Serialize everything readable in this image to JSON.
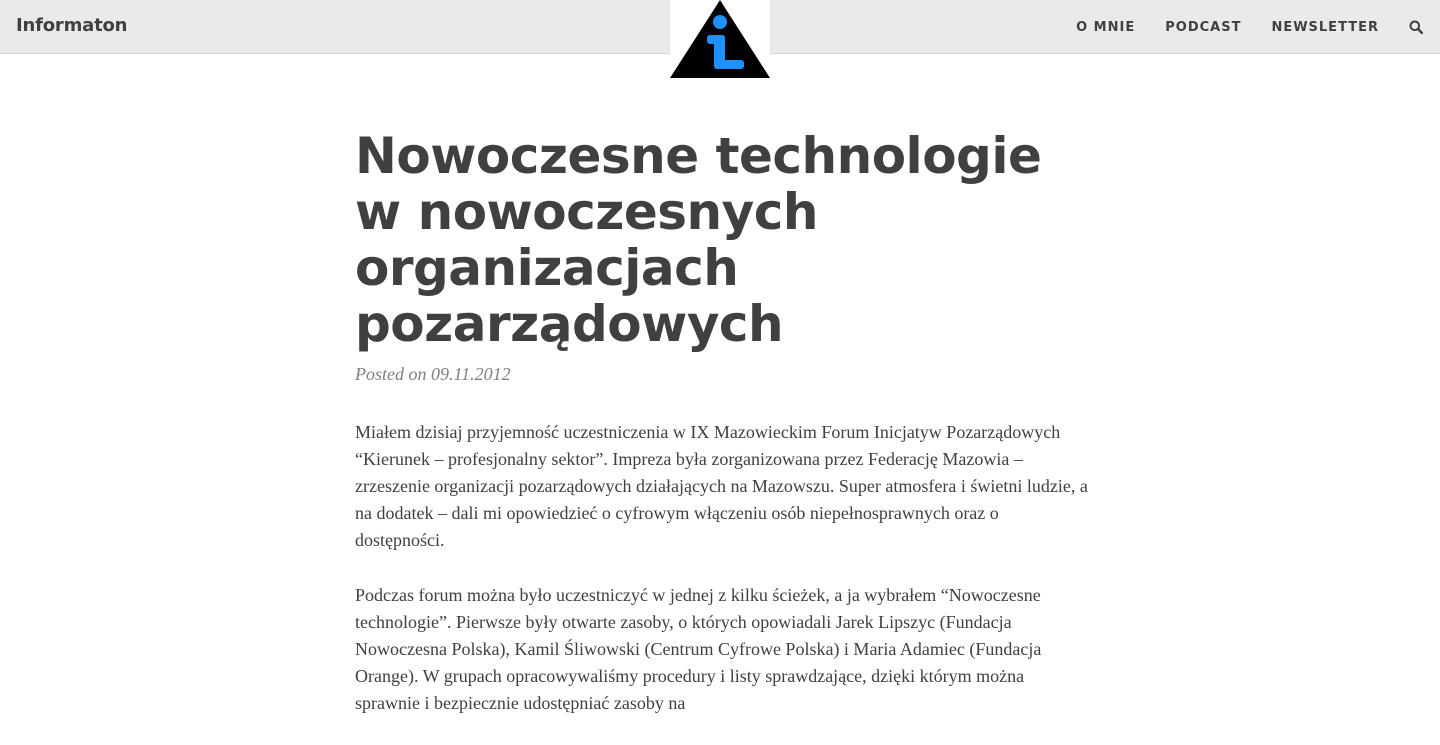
{
  "header": {
    "brand": "Informaton",
    "logo_icon": "info-warning-triangle-icon",
    "nav": [
      {
        "label": "O MNIE"
      },
      {
        "label": "PODCAST"
      },
      {
        "label": "NEWSLETTER"
      }
    ],
    "search_icon": "search-icon",
    "colors": {
      "bar": "#eaeaea",
      "logo_blue": "#1e90ff",
      "logo_black": "#000000"
    }
  },
  "post": {
    "title": "Nowoczesne technologie w nowoczesnych organizacjach pozarządowych",
    "meta_prefix": "Posted on",
    "date": "09.11.2012",
    "paragraphs": [
      "Miałem dzisiaj przyjemność uczestniczenia w IX Mazowieckim Forum Inicjatyw Pozarządowych “Kierunek – profesjonalny sektor”. Impreza była zorganizowana przez Federację Mazowia – zrzeszenie organizacji pozarządowych działających na Mazowszu. Super atmosfera i świetni ludzie, a na dodatek – dali mi opowiedzieć o cyfrowym włączeniu osób niepełnosprawnych oraz o dostępności.",
      "Podczas forum można było uczestniczyć w jednej z kilku ścieżek, a ja wybrałem “Nowoczesne technologie”. Pierwsze były otwarte zasoby, o których opowiadali Jarek Lipszyc (Fundacja Nowoczesna Polska), Kamil Śliwowski (Centrum Cyfrowe Polska) i Maria Adamiec (Fundacja Orange). W grupach opracowywaliśmy procedury i listy sprawdzające, dzięki którym można sprawnie i bezpiecznie udostępniać zasoby na"
    ]
  }
}
